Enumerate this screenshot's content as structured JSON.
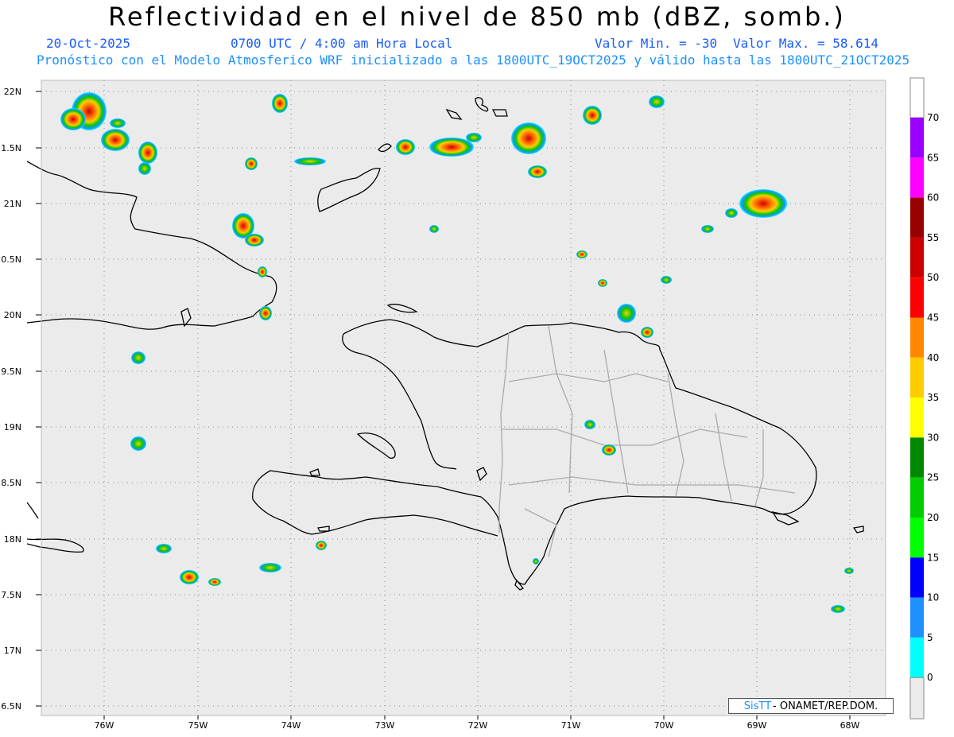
{
  "title": "Reflectividad en el nivel de 850 mb (dBZ, somb.)",
  "date": "20-Oct-2025",
  "time": "0700 UTC / 4:00 am Hora Local",
  "valmin": "Valor Min. = -30",
  "valmax": "Valor Max. = 58.614",
  "forecast": "Pronóstico con el Modelo Atmosferico WRF inicializado a las 1800UTC_19OCT2025 y válido hasta las  1800UTC_21OCT2025",
  "lat_labels": [
    "22N",
    "1.5N",
    "21N",
    "0.5N",
    "20N",
    "9.5N",
    "19N",
    "8.5N",
    "18N",
    "7.5N",
    "17N",
    "6.5N"
  ],
  "lon_labels": [
    "76W",
    "75W",
    "74W",
    "73W",
    "72W",
    "71W",
    "70W",
    "69W",
    "68W"
  ],
  "colorbar": {
    "ticks": [
      "0",
      "5",
      "10",
      "15",
      "20",
      "25",
      "30",
      "35",
      "40",
      "45",
      "50",
      "55",
      "60",
      "65",
      "70"
    ],
    "colors": [
      "#00ffff",
      "#1e90ff",
      "#0000ff",
      "#00ff00",
      "#00cc00",
      "#008800",
      "#ffff00",
      "#ffcc00",
      "#ff8800",
      "#ff0000",
      "#cc0000",
      "#990000",
      "#ff00ff",
      "#9900ff",
      "#ffffff"
    ]
  },
  "credit": {
    "logo": "SisTT",
    "text": "- ONAMET/REP.DOM."
  }
}
